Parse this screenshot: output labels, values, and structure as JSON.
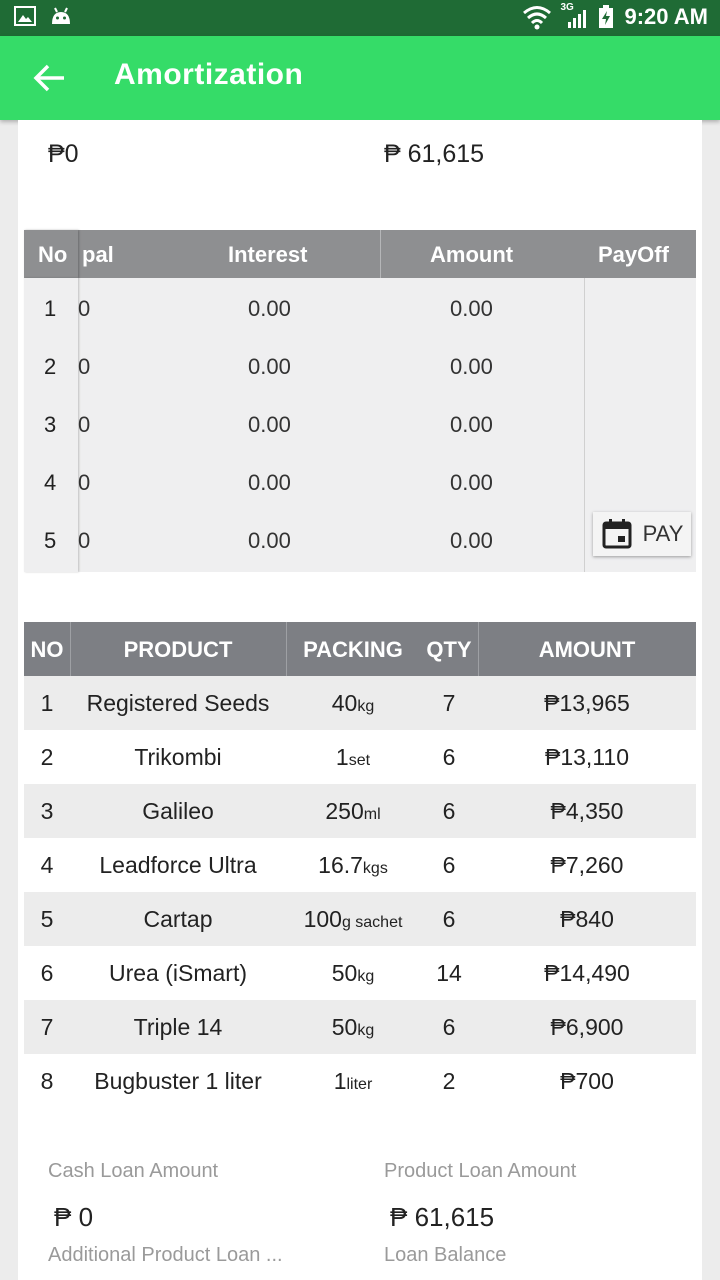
{
  "status_bar": {
    "time": "9:20 AM",
    "network": "3G"
  },
  "app_bar": {
    "title": "Amortization"
  },
  "top_values": {
    "left": "₱0",
    "right": "₱ 61,615"
  },
  "amortization": {
    "headers": {
      "no": "No",
      "principal": "pal",
      "interest": "Interest",
      "amount": "Amount",
      "payoff": "PayOff"
    },
    "rows": [
      {
        "no": "1",
        "principal": "0",
        "interest": "0.00",
        "amount": "0.00"
      },
      {
        "no": "2",
        "principal": "0",
        "interest": "0.00",
        "amount": "0.00"
      },
      {
        "no": "3",
        "principal": "0",
        "interest": "0.00",
        "amount": "0.00"
      },
      {
        "no": "4",
        "principal": "0",
        "interest": "0.00",
        "amount": "0.00"
      },
      {
        "no": "5",
        "principal": "0",
        "interest": "0.00",
        "amount": "0.00"
      }
    ],
    "pay_button": "PAY"
  },
  "products": {
    "headers": {
      "no": "NO",
      "product": "PRODUCT",
      "packing": "PACKING",
      "qty": "QTY",
      "amount": "AMOUNT"
    },
    "rows": [
      {
        "no": "1",
        "product": "Registered Seeds",
        "pack_num": "40",
        "pack_unit": "kg",
        "qty": "7",
        "amount": "₱13,965"
      },
      {
        "no": "2",
        "product": "Trikombi",
        "pack_num": "1",
        "pack_unit": "set",
        "qty": "6",
        "amount": "₱13,110"
      },
      {
        "no": "3",
        "product": "Galileo",
        "pack_num": "250",
        "pack_unit": "ml",
        "qty": "6",
        "amount": "₱4,350"
      },
      {
        "no": "4",
        "product": "Leadforce Ultra",
        "pack_num": "16.7",
        "pack_unit": "kgs",
        "qty": "6",
        "amount": "₱7,260"
      },
      {
        "no": "5",
        "product": "Cartap",
        "pack_num": "100",
        "pack_unit": "g sachet",
        "qty": "6",
        "amount": "₱840"
      },
      {
        "no": "6",
        "product": "Urea (iSmart)",
        "pack_num": "50",
        "pack_unit": "kg",
        "qty": "14",
        "amount": "₱14,490"
      },
      {
        "no": "7",
        "product": "Triple 14",
        "pack_num": "50",
        "pack_unit": "kg",
        "qty": "6",
        "amount": "₱6,900"
      },
      {
        "no": "8",
        "product": "Bugbuster 1 liter",
        "pack_num": "1",
        "pack_unit": "liter",
        "qty": "2",
        "amount": "₱700"
      }
    ]
  },
  "summary": {
    "cash_loan_label": "Cash Loan Amount",
    "cash_loan_value": "₱ 0",
    "product_loan_label": "Product Loan Amount",
    "product_loan_value": "₱ 61,615",
    "additional_label": "Additional Product Loan ...",
    "balance_label": "Loan Balance"
  }
}
